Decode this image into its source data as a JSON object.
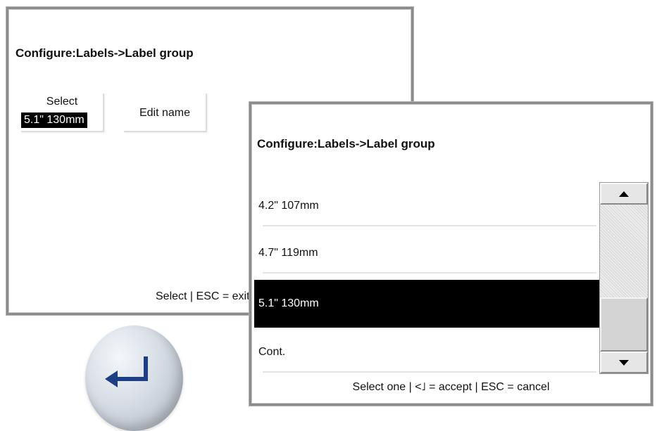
{
  "back_screen": {
    "title": "Configure:Labels->Label group",
    "select_key": {
      "caption": "Select",
      "value": "5.1\" 130mm"
    },
    "edit_name_key": {
      "caption": "Edit name"
    },
    "hint": "Select | ESC = exit"
  },
  "front_screen": {
    "title": "Configure:Labels->Label group",
    "items": [
      {
        "label": "4.2\" 107mm",
        "selected": false
      },
      {
        "label": "4.7\" 119mm",
        "selected": false
      },
      {
        "label": "5.1\" 130mm",
        "selected": true
      },
      {
        "label": "Cont.",
        "selected": false
      }
    ],
    "hint": "Select one | <˩ = accept | ESC = cancel",
    "scroll_up_icon": "up-arrow-icon",
    "scroll_down_icon": "down-arrow-icon"
  },
  "enter_key": {
    "icon": "enter-arrow-icon",
    "accent": "#1e3f86"
  }
}
